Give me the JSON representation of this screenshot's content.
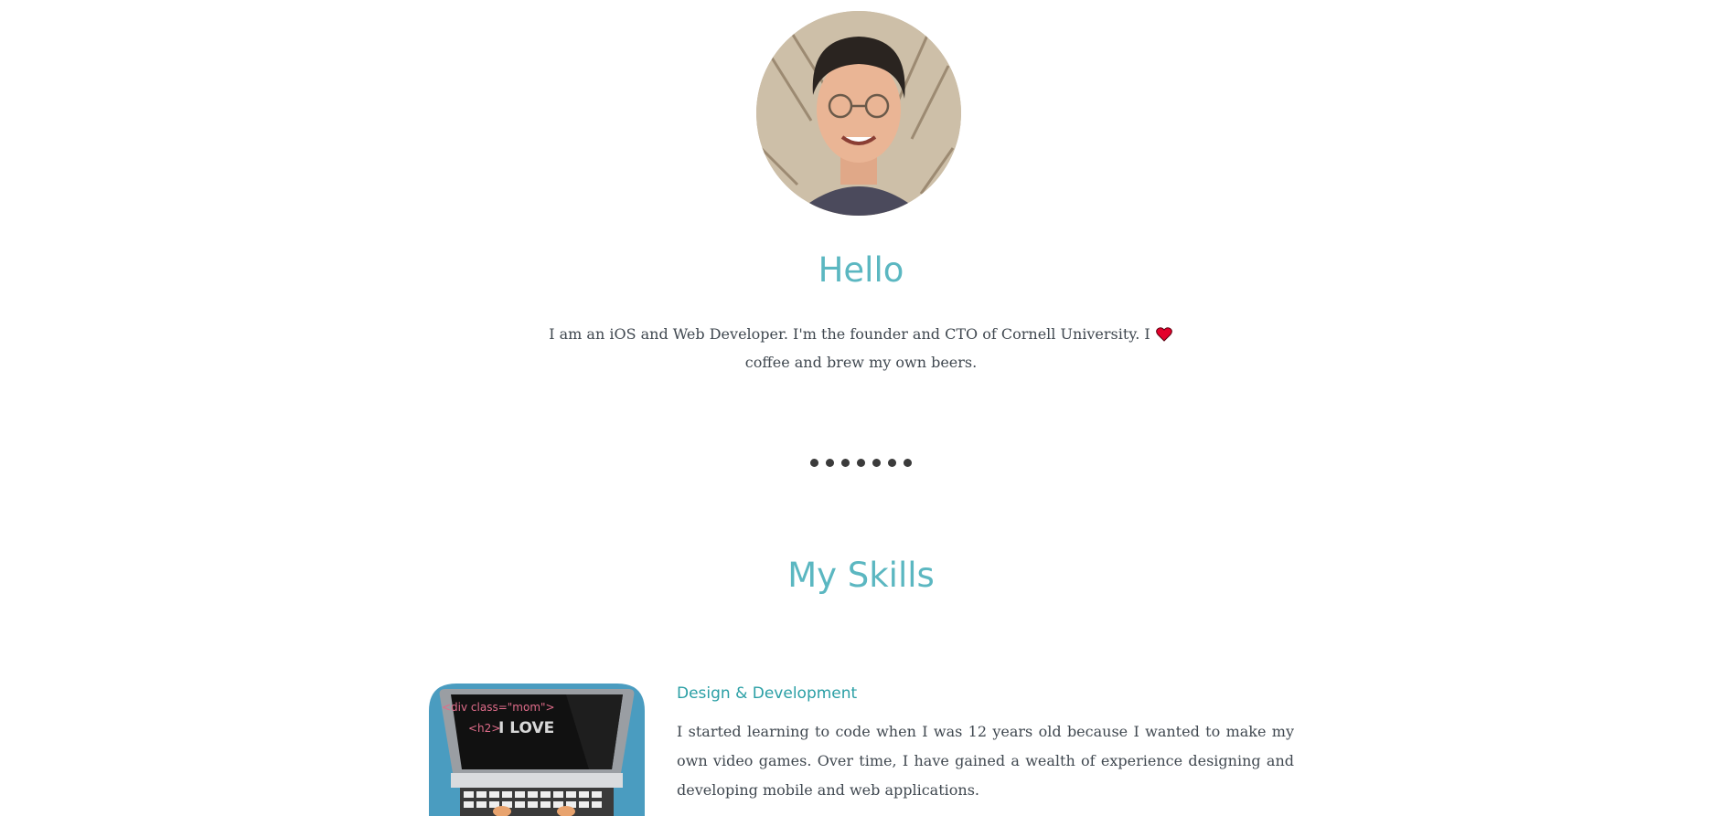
{
  "profile": {
    "avatar_icon": "profile-photo",
    "greeting": "Hello",
    "intro_before": "I am an iOS and Web Developer. I'm the founder and CTO of Cornell University. I",
    "intro_icon": "heart-icon",
    "intro_after": "coffee and brew my own beers."
  },
  "divider": {
    "dot_count": 7
  },
  "skills": {
    "title": "My Skills",
    "items": [
      {
        "image_icon": "laptop-illustration",
        "code_line_1": "<div class=\"mom\">",
        "code_line_2_tag": "<h2>",
        "code_line_2_text": "I LOVE",
        "heading": "Design & Development",
        "text": "I started learning to code when I was 12 years old because I wanted to make my own video games. Over time, I have gained a wealth of experience designing and developing mobile and web applications."
      }
    ]
  },
  "colors": {
    "accent": "#5bb7c1",
    "skill_heading": "#2a9fa5",
    "text": "#404850",
    "heart": "#e4002b",
    "dots": "#3b3b3b",
    "laptop_bg": "#4a9cc0"
  }
}
